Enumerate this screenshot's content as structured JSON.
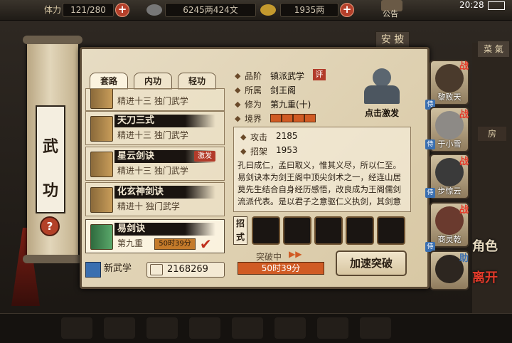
{
  "topbar": {
    "stamina_label": "体力",
    "stamina_value": "121/280",
    "silver_value": "6245两424文",
    "gold_value": "1935两",
    "announce_label": "公告",
    "clock": "20:28"
  },
  "bg": {
    "roof_sign": "安 披",
    "right_sign": "菜 氣",
    "right_tab": "房"
  },
  "scroll": {
    "char1": "武",
    "char2": "功",
    "help_glyph": "?"
  },
  "tabs": [
    {
      "label": "套路"
    },
    {
      "label": "内功"
    },
    {
      "label": "轻功"
    }
  ],
  "skills": [
    {
      "name": "",
      "sub": "精进十三  独门武学"
    },
    {
      "name": "天刀三式",
      "sub": "精进十三  独门武学"
    },
    {
      "name": "星云剑诀",
      "sub": "精进十三  独门武学",
      "tag": "激发"
    },
    {
      "name": "化玄神剑诀",
      "sub": "精进十   独门武学"
    },
    {
      "name": "易剑诀",
      "sub": "第九重",
      "timer": "50时39分"
    }
  ],
  "footer": {
    "new_skill_label": "新武学",
    "points": "2168269"
  },
  "info": {
    "rank_label": "品阶",
    "rank_value": "镇派武学",
    "rank_badge": "评",
    "sect_label": "所属",
    "sect_value": "剑王阁",
    "cult_label": "修为",
    "cult_value": "第九重(十)",
    "realm_label": "境界",
    "activate_label": "点击激发",
    "attack_label": "攻击",
    "attack_value": "2185",
    "parry_label": "招架",
    "parry_value": "1953",
    "description": "孔曰成仁，孟曰取义，惟其义尽，所以仁至。易剑诀本为剑王阁中顶尖剑术之一，经连山居莫先生结合自身经历感悟，改良成为王阁儒剑流派代表。是以君子之意驱仁义执剑，其剑意招式之间平稳如泰山，注重团",
    "moves_label": "招式",
    "breakthrough_label": "突破中",
    "breakthrough_timer": "50时39分",
    "speedup_label": "加速突破"
  },
  "characters": [
    {
      "name": "黎败天",
      "fight": "战",
      "def": "侍"
    },
    {
      "name": "于小雪",
      "fight": "战",
      "def": "侍"
    },
    {
      "name": "步惊云",
      "fight": "战",
      "def": "侍"
    },
    {
      "name": "商灵乾",
      "fight": "战",
      "def": "侍"
    },
    {
      "name": "",
      "fight": "助",
      "def": ""
    }
  ],
  "right_actions": {
    "role": "角色",
    "leave": "离开"
  },
  "colors": {
    "accent_red": "#c0301e",
    "bar_orange": "#d05b24",
    "parchment": "#e7dcc3"
  }
}
